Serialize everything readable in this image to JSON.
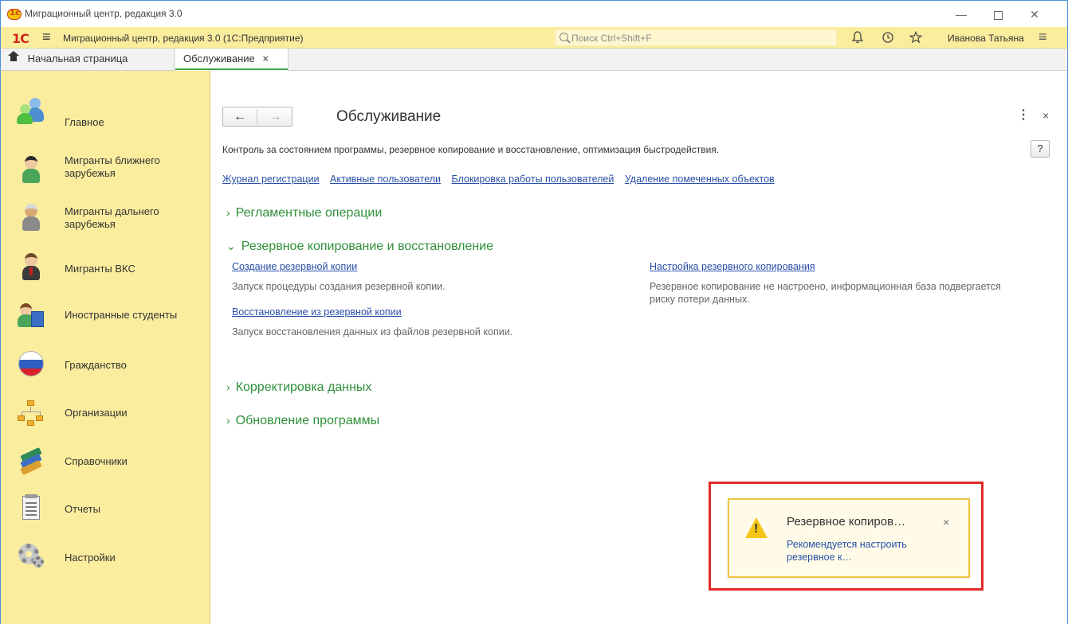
{
  "window": {
    "title": "Миграционный центр, редакция 3.0",
    "min_glyph": "—",
    "close_glyph": "✕"
  },
  "appbar": {
    "logo": "1C",
    "menu_glyph": "≡",
    "title": "Миграционный центр, редакция 3.0  (1С:Предприятие)",
    "search_placeholder": "Поиск Ctrl+Shift+F",
    "bell_glyph": "🔔",
    "history_glyph": "⟲",
    "star_glyph": "☆",
    "user": "Иванова Татьяна",
    "user_menu_glyph": "≡"
  },
  "tabs": {
    "home": "Начальная страница",
    "active": "Обслуживание",
    "close_glyph": "×"
  },
  "sidebar": {
    "items": [
      {
        "label": "Главное",
        "icon": "people-icon"
      },
      {
        "label": "Мигранты ближнего зарубежья",
        "icon": "migrant-near-icon"
      },
      {
        "label": "Мигранты дальнего зарубежья",
        "icon": "migrant-far-icon"
      },
      {
        "label": "Мигранты ВКС",
        "icon": "migrant-vks-icon"
      },
      {
        "label": "Иностранные студенты",
        "icon": "student-icon"
      },
      {
        "label": "Гражданство",
        "icon": "flag-icon"
      },
      {
        "label": "Организации",
        "icon": "org-structure-icon"
      },
      {
        "label": "Справочники",
        "icon": "books-icon"
      },
      {
        "label": "Отчеты",
        "icon": "report-icon"
      },
      {
        "label": "Настройки",
        "icon": "gear-icon"
      }
    ]
  },
  "main": {
    "back_glyph": "←",
    "forward_glyph": "→",
    "title": "Обслуживание",
    "more_glyph": "⋮",
    "close_glyph": "×",
    "help_label": "?",
    "description": "Контроль за состоянием программы, резервное копирование и восстановление, оптимизация быстродействия.",
    "links": [
      "Журнал регистрации",
      "Активные пользователи",
      "Блокировка работы пользователей",
      "Удаление помеченных объектов"
    ],
    "sections": {
      "routine": {
        "chev": "›",
        "label": "Регламентные операции"
      },
      "backup": {
        "chev": "⌄",
        "label": "Резервное копирование и восстановление",
        "create_link": "Создание резервной копии",
        "create_note": "Запуск процедуры создания резервной копии.",
        "restore_link": "Восстановление из резервной копии",
        "restore_note": "Запуск восстановления данных из файлов резервной копии.",
        "settings_link": "Настройка резервного копирования",
        "settings_note": "Резервное копирование не настроено, информационная база подвергается риску потери данных."
      },
      "correction": {
        "chev": "›",
        "label": "Корректировка данных"
      },
      "update": {
        "chev": "›",
        "label": "Обновление программы"
      }
    }
  },
  "notification": {
    "title": "Резервное копиров…",
    "close_glyph": "×",
    "text": "Рекомендуется настроить резервное к…",
    "accent": "#f0c640",
    "highlight": "#e02a2a"
  },
  "colors": {
    "panel": "#fbed9e",
    "section_green": "#2f8f3a",
    "link_blue": "#2a4fa8",
    "tab_active_line": "#3ea646"
  }
}
